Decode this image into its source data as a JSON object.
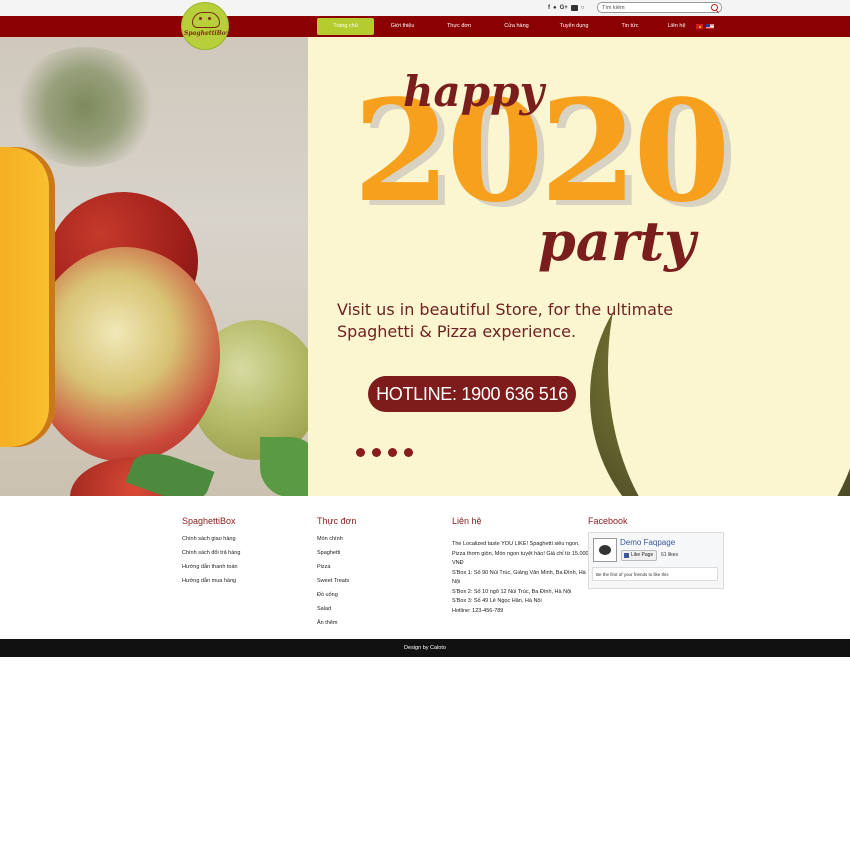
{
  "topbar": {
    "social": [
      "f",
      "t",
      "G+",
      "yt",
      "ig"
    ],
    "search": {
      "placeholder": "Tìm kiếm"
    }
  },
  "logo": {
    "text": "SpaghettiBox"
  },
  "nav": {
    "items": [
      {
        "label": "Trang chủ",
        "active": true
      },
      {
        "label": "Giới thiệu",
        "active": false
      },
      {
        "label": "Thực đơn",
        "active": false
      },
      {
        "label": "Cửa hàng",
        "active": false
      },
      {
        "label": "Tuyển dụng",
        "active": false
      },
      {
        "label": "Tin tức",
        "active": false
      },
      {
        "label": "Liên hệ",
        "active": false
      }
    ],
    "languages": [
      "vi",
      "en"
    ]
  },
  "hero": {
    "happy": "happy",
    "year": "2020",
    "party": "party",
    "tagline_1": "Visit us in beautiful Store, for the ultimate",
    "tagline_2": "Spaghetti & Pizza experience.",
    "hotline": "HOTLINE: 1900 636 516",
    "slide_count": 4
  },
  "footer": {
    "col1": {
      "title": "SpaghettiBox",
      "links": [
        "Chính sách giao hàng",
        "Chính sách đổi trả hàng",
        "Hướng dẫn thanh toán",
        "Hướng dẫn mua hàng"
      ]
    },
    "col2": {
      "title": "Thực đơn",
      "links": [
        "Món chính",
        "Spaghetti",
        "Pizza",
        "Sweet Treats",
        "Đồ uống",
        "Salad",
        "Ăn thêm"
      ]
    },
    "col3": {
      "title": "Liên hệ",
      "lines": [
        "The Localized taste YOU LIKE! Spaghetti siêu ngon, Pizza thơm giòn, Món ngon tuyệt hảo! Giá chỉ từ 15.000 VNĐ",
        "S'Box 1: Số 90 Núi Trúc, Giảng Văn Minh, Ba Đình, Hà Nội",
        "S'Box 2: Số 10 ngõ 12 Núi Trúc, Ba Đình, Hà Nội",
        "S'Box 3: Số 49 Lê Ngọc Hân, Hà Nội",
        "Hotline: 123-456-789"
      ]
    },
    "col4": {
      "title": "Facebook",
      "page_name": "Demo Faqpage",
      "like_label": "Like Page",
      "likes": "61 likes",
      "friends_text": "Be the first of your friends to like this"
    },
    "copyright": "Design by Caloto"
  }
}
